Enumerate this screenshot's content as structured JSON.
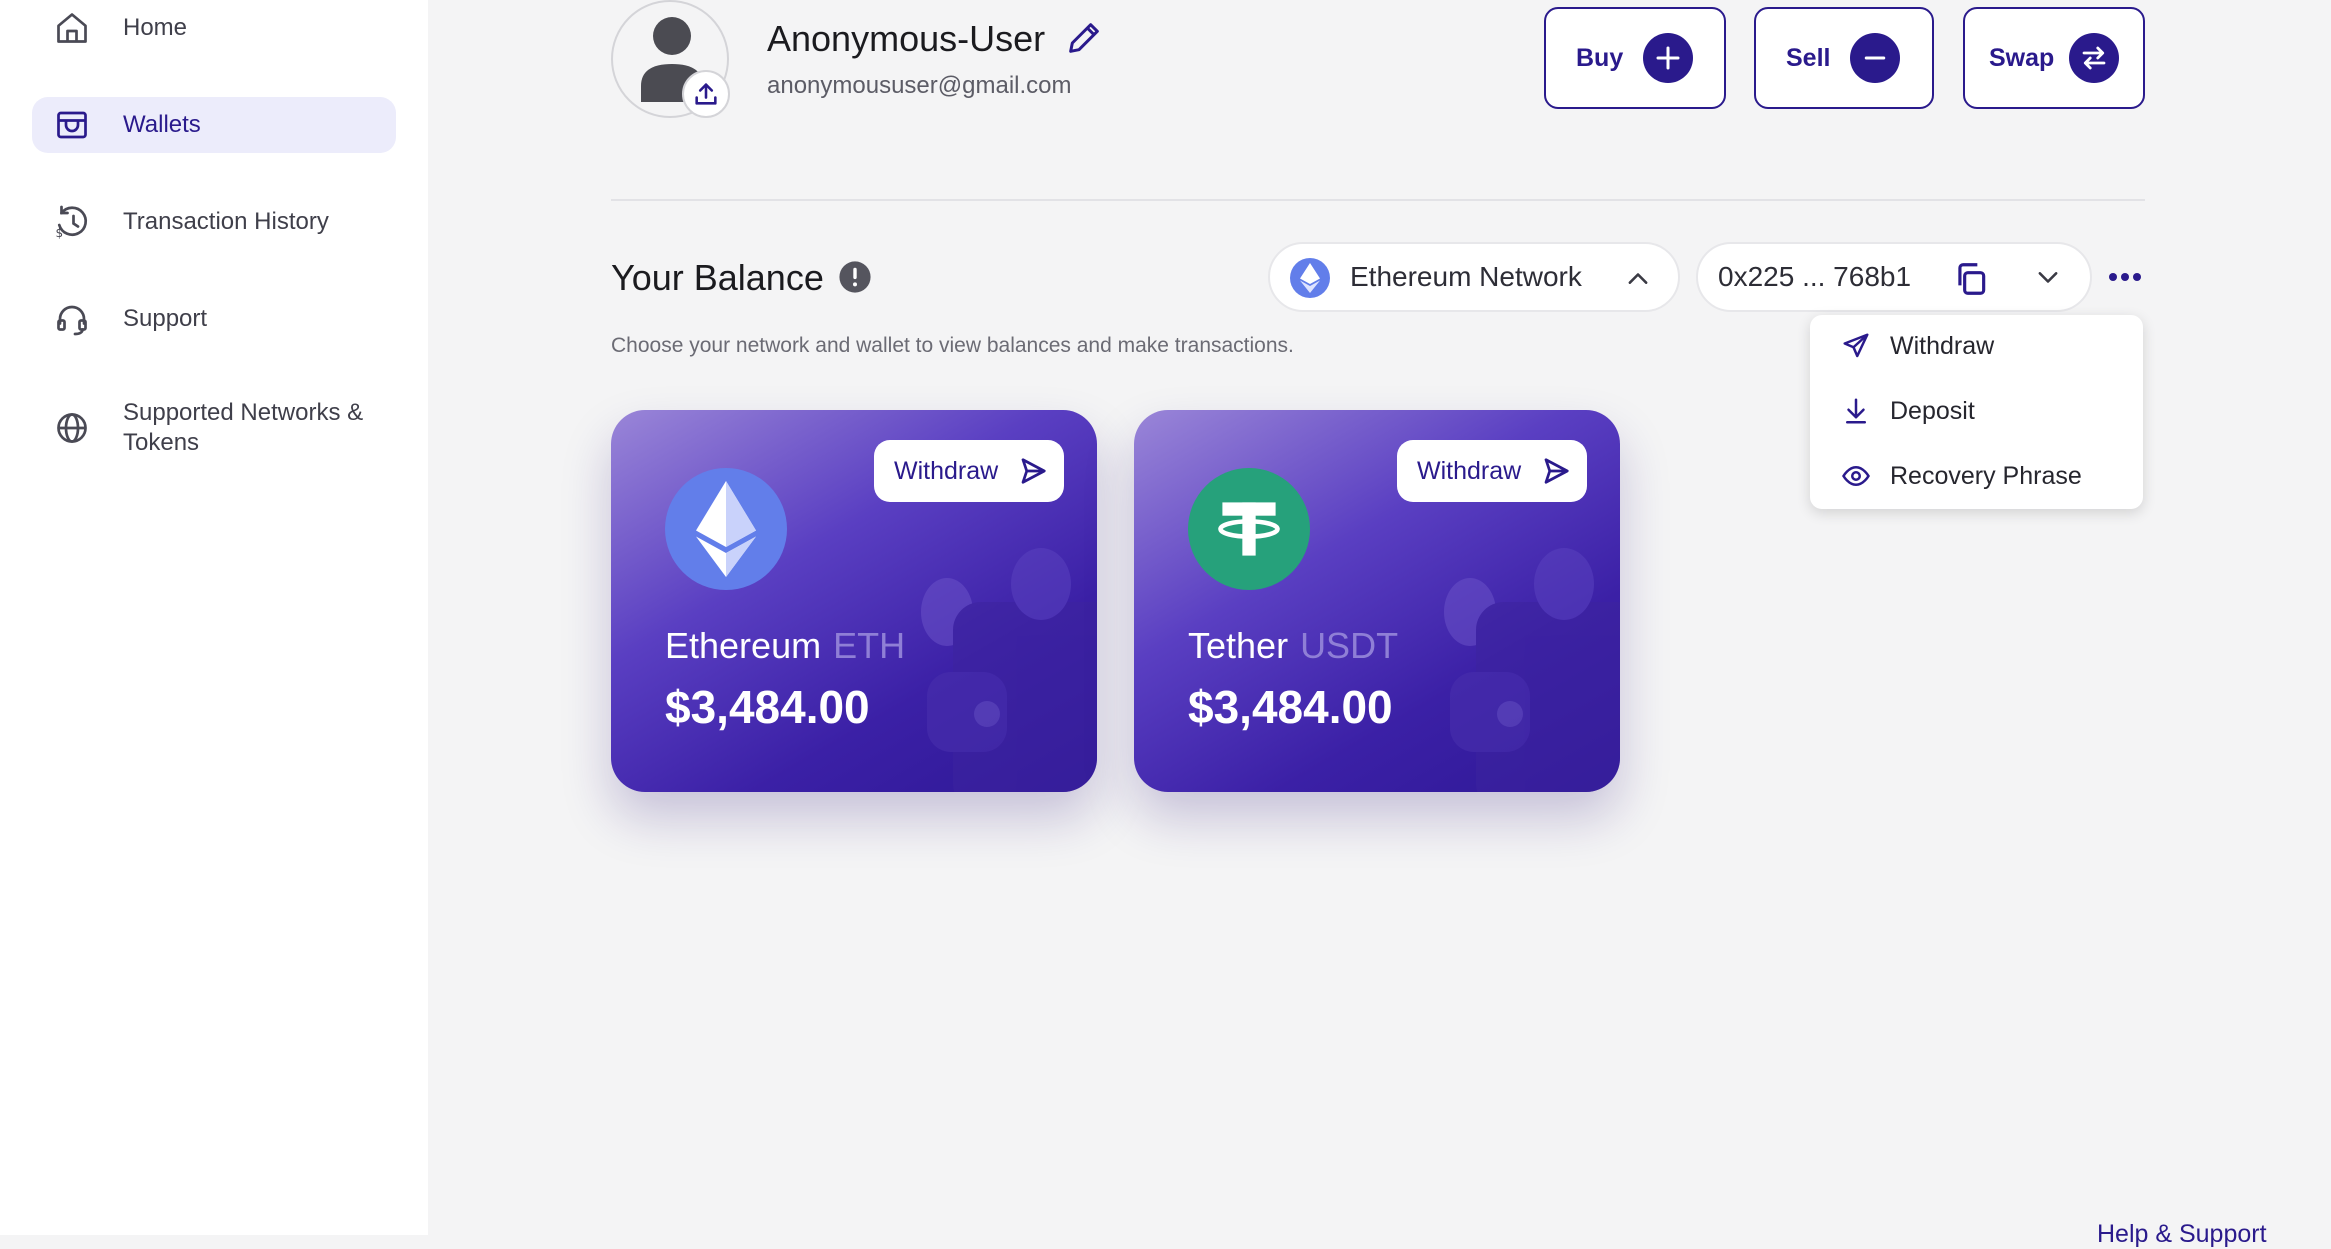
{
  "sidebar": {
    "items": [
      {
        "label": "Home",
        "icon": "home-icon",
        "active": false
      },
      {
        "label": "Wallets",
        "icon": "wallet-icon",
        "active": true
      },
      {
        "label": "Transaction History",
        "icon": "history-icon",
        "active": false
      },
      {
        "label": "Support",
        "icon": "headset-icon",
        "active": false
      },
      {
        "label": "Supported Networks & Tokens",
        "icon": "globe-icon",
        "active": false
      }
    ]
  },
  "profile": {
    "name": "Anonymous-User",
    "email": "anonymoususer@gmail.com"
  },
  "actions": {
    "buy_label": "Buy",
    "sell_label": "Sell",
    "swap_label": "Swap"
  },
  "balance": {
    "title": "Your Balance",
    "subtitle": "Choose your network and wallet to view balances and make transactions.",
    "network_selected": "Ethereum Network",
    "wallet_address": "0x225 ... 768b1"
  },
  "menu": {
    "items": [
      {
        "label": "Withdraw",
        "icon": "send-icon"
      },
      {
        "label": "Deposit",
        "icon": "download-icon"
      },
      {
        "label": "Recovery Phrase",
        "icon": "eye-icon"
      }
    ]
  },
  "cards": [
    {
      "name": "Ethereum",
      "symbol": "ETH",
      "amount": "$3,484.00",
      "withdraw_label": "Withdraw",
      "logo_color": "#627eea"
    },
    {
      "name": "Tether",
      "symbol": "USDT",
      "amount": "$3,484.00",
      "withdraw_label": "Withdraw",
      "logo_color": "#26a17b"
    }
  ],
  "footer": {
    "help_label": "Help & Support"
  },
  "colors": {
    "accent": "#2a1a8c",
    "active_nav_bg": "#ececfb"
  }
}
